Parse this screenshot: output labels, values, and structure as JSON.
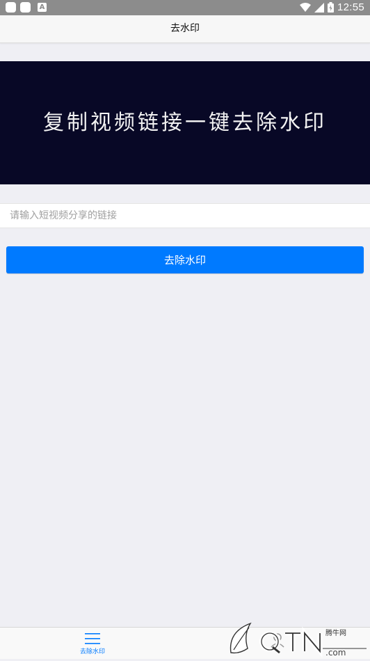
{
  "status_bar": {
    "time": "12:55",
    "icons": [
      "notification-icon",
      "notification-icon",
      "a-icon",
      "wifi-icon",
      "signal-icon",
      "battery-icon"
    ]
  },
  "header": {
    "title": "去水印"
  },
  "banner": {
    "text": "复制视频链接一键去除水印"
  },
  "form": {
    "input_placeholder": "请输入短视频分享的链接",
    "input_value": "",
    "button_label": "去除水印"
  },
  "tabbar": {
    "items": [
      {
        "label": "去除水印",
        "icon": "menu-icon",
        "active": true
      },
      {
        "label": "",
        "icon": "user-icon",
        "active": false
      }
    ]
  },
  "watermark": {
    "text": "腾牛网"
  },
  "colors": {
    "accent": "#007aff",
    "banner_bg": "#080826",
    "page_bg": "#efeff4"
  }
}
